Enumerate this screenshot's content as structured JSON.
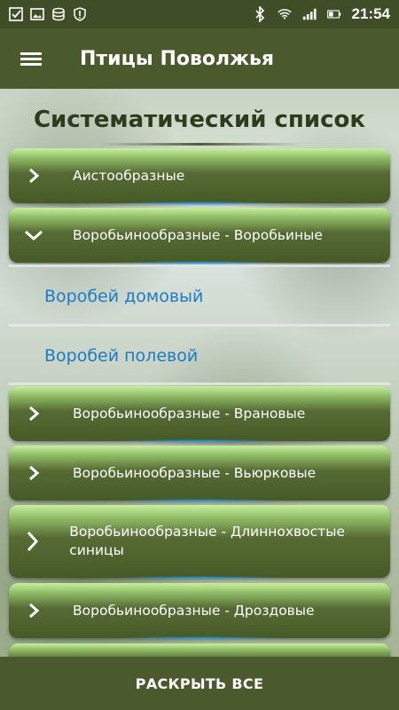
{
  "status_bar": {
    "time": "21:54",
    "left_icons": [
      "checkbox-icon",
      "image-icon",
      "storage-icon",
      "alert-icon"
    ],
    "right_icons": [
      "bluetooth-icon",
      "wifi-icon",
      "signal-icon",
      "battery-icon"
    ]
  },
  "app_bar": {
    "title": "Птицы Поволжья",
    "menu_icon": "hamburger-menu-icon"
  },
  "list": {
    "title": "Систематический список",
    "groups": [
      {
        "label": "Аистообразные",
        "expanded": false
      },
      {
        "label": "Воробьинообразные - Воробьиные",
        "expanded": true,
        "children": [
          "Воробей домовый",
          "Воробей полевой"
        ]
      },
      {
        "label": "Воробьинообразные - Врановые",
        "expanded": false
      },
      {
        "label": "Воробьинообразные - Вьюрковые",
        "expanded": false
      },
      {
        "label": "Воробьинообразные - Длиннохвостые синицы",
        "expanded": false
      },
      {
        "label": "Воробьинообразные - Дроздовые",
        "expanded": false
      }
    ]
  },
  "bottom_bar": {
    "expand_all_label": "РАСКРЫТЬ ВСЕ"
  },
  "colors": {
    "bar": "#4b5a2d",
    "status_bar": "#3f4e26",
    "child_text": "#1e7ac5",
    "title_text": "#2f3c1b"
  }
}
